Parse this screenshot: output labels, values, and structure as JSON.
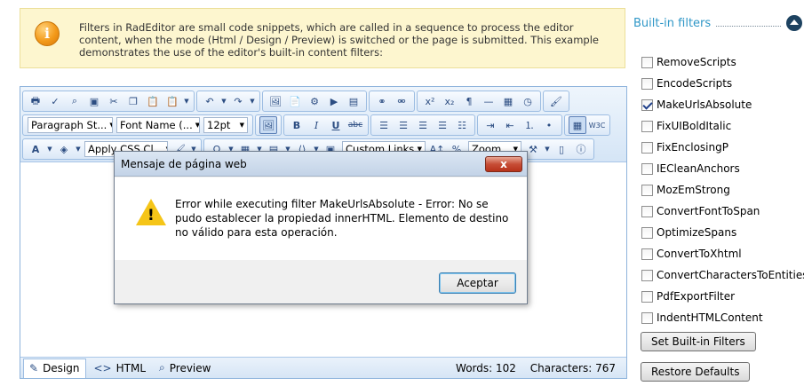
{
  "info": {
    "text": "Filters in RadEditor are small code snippets, which are called in a sequence to process the editor content, when the mode (Html / Design / Preview) is switched or the page is submitted. This example demonstrates the use of the editor's built-in content filters:"
  },
  "toolbar": {
    "paragraph_style": "Paragraph St...",
    "font_name": "Font Name (...",
    "font_size": "12pt",
    "css_class": "Apply CSS Cl...",
    "custom_links": "Custom Links",
    "zoom": "Zoom"
  },
  "status": {
    "modes": [
      "Design",
      "HTML",
      "Preview"
    ],
    "words_label": "Words: 102",
    "chars_label": "Characters: 767"
  },
  "dialog": {
    "title": "Mensaje de página web",
    "message": "Error while executing filter MakeUrlsAbsolute - Error: No se pudo establecer la propiedad  innerHTML. Elemento de destino no válido para esta operación.",
    "ok_label": "Aceptar",
    "close_label": "x"
  },
  "panel": {
    "title": "Built-in filters",
    "filters": [
      {
        "label": "RemoveScripts",
        "checked": false
      },
      {
        "label": "EncodeScripts",
        "checked": false
      },
      {
        "label": "MakeUrlsAbsolute",
        "checked": true
      },
      {
        "label": "FixUIBoldItalic",
        "checked": false
      },
      {
        "label": "FixEnclosingP",
        "checked": false
      },
      {
        "label": "IECleanAnchors",
        "checked": false
      },
      {
        "label": "MozEmStrong",
        "checked": false
      },
      {
        "label": "ConvertFontToSpan",
        "checked": false
      },
      {
        "label": "OptimizeSpans",
        "checked": false
      },
      {
        "label": "ConvertToXhtml",
        "checked": false
      },
      {
        "label": "ConvertCharactersToEntities",
        "checked": false
      },
      {
        "label": "PdfExportFilter",
        "checked": false
      },
      {
        "label": "IndentHTMLContent",
        "checked": false
      }
    ],
    "set_button": "Set Built-in Filters",
    "restore_button": "Restore Defaults"
  }
}
